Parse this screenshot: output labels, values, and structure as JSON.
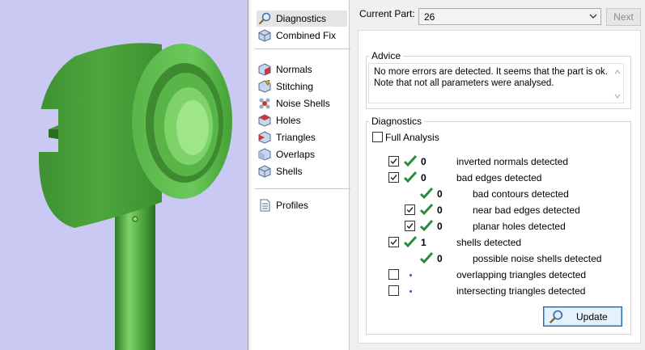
{
  "navigation": {
    "items": [
      {
        "label": "Diagnostics",
        "icon": "magnifier-icon",
        "active": true
      },
      {
        "label": "Combined Fix",
        "icon": "cube-icon"
      },
      {
        "label": "Normals",
        "icon": "normals-cube-icon"
      },
      {
        "label": "Stitching",
        "icon": "stitching-cube-icon"
      },
      {
        "label": "Noise Shells",
        "icon": "noise-shells-icon"
      },
      {
        "label": "Holes",
        "icon": "holes-cube-icon"
      },
      {
        "label": "Triangles",
        "icon": "triangles-cube-icon"
      },
      {
        "label": "Overlaps",
        "icon": "overlaps-cube-icon"
      },
      {
        "label": "Shells",
        "icon": "shells-cube-icon"
      },
      {
        "label": "Profiles",
        "icon": "document-icon"
      }
    ]
  },
  "header": {
    "current_part_label": "Current Part:",
    "current_part_value": "26",
    "next_label": "Next"
  },
  "advice": {
    "title": "Advice",
    "line1": "No more errors are detected. It seems that the part is ok.",
    "line2": "Note that not all parameters were analysed."
  },
  "diagnostics": {
    "title": "Diagnostics",
    "full_analysis_label": "Full Analysis",
    "rows": [
      {
        "checked": true,
        "status": "ok",
        "count": "0",
        "label": "inverted normals detected"
      },
      {
        "checked": true,
        "status": "ok",
        "count": "0",
        "label": "bad edges detected"
      },
      {
        "checked": null,
        "status": "ok",
        "count": "0",
        "label": "bad contours detected"
      },
      {
        "checked": true,
        "status": "ok",
        "count": "0",
        "label": "near bad edges detected"
      },
      {
        "checked": true,
        "status": "ok",
        "count": "0",
        "label": "planar holes detected"
      },
      {
        "checked": true,
        "status": "ok",
        "count": "1",
        "label": "shells detected"
      },
      {
        "checked": null,
        "status": "ok",
        "count": "0",
        "label": "possible noise shells detected"
      },
      {
        "checked": false,
        "status": "pending",
        "count": "",
        "label": "overlapping triangles detected"
      },
      {
        "checked": false,
        "status": "pending",
        "count": "",
        "label": "intersecting triangles detected"
      }
    ],
    "update_label": "Update"
  },
  "colors": {
    "viewport_background": "#c9c9f4",
    "model_green": "#4aa33a",
    "ok_tick": "#2e8b3e",
    "accent": "#2b6bb6"
  }
}
